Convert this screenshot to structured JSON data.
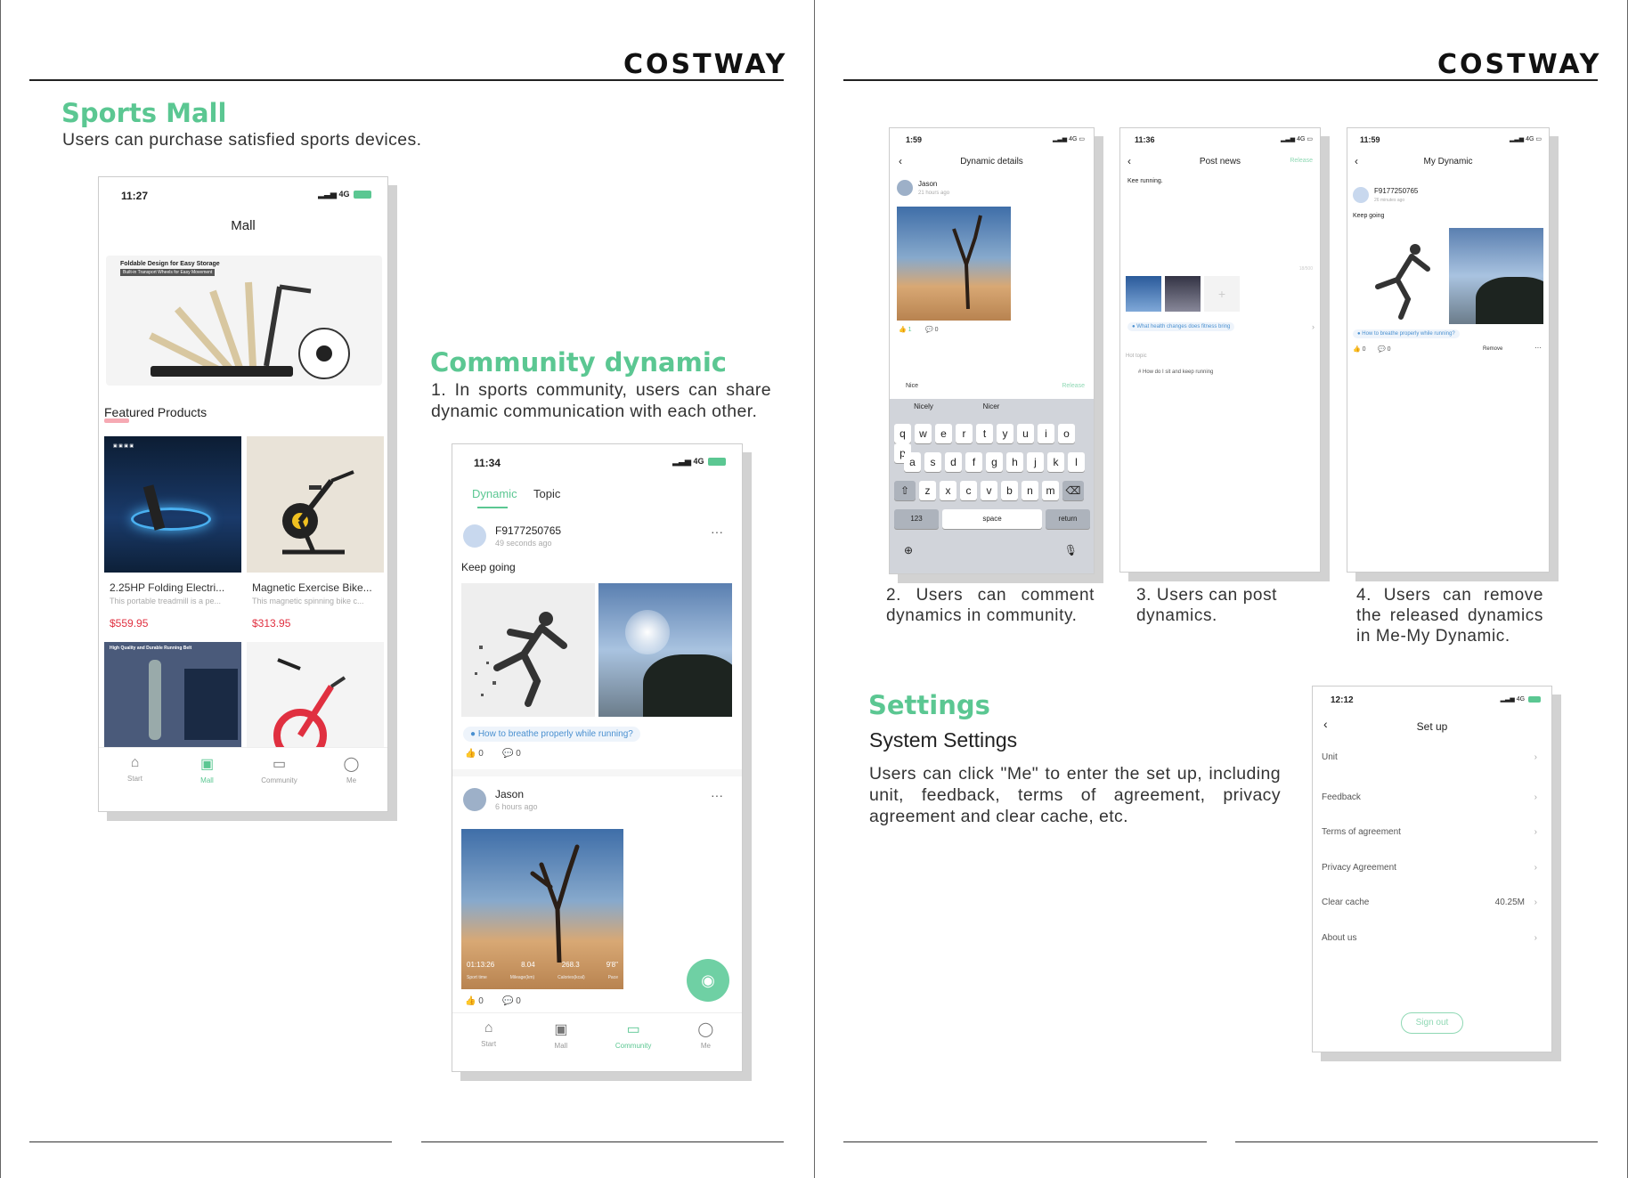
{
  "brand": "COSTWAY",
  "left_page": {
    "sports_mall": {
      "title": "Sports Mall",
      "subtitle": "Users can purchase satisfied sports devices."
    },
    "community": {
      "title": "Community dynamic",
      "caption": "1. In sports community, users can share dynamic communication with each other."
    },
    "mall_phone": {
      "time": "11:27",
      "signal": "4G",
      "header": "Mall",
      "banner_title": "Foldable Design for Easy Storage",
      "banner_sub": "Built-in Transport Wheels for Easy Movement",
      "featured": "Featured Products",
      "products": [
        {
          "name": "2.25HP Folding Electri...",
          "desc": "This portable treadmill is a pe...",
          "price": "$559.95"
        },
        {
          "name": "Magnetic Exercise Bike...",
          "desc": "This magnetic spinning bike c...",
          "price": "$313.95"
        }
      ],
      "product3_banner": "High Quality and Durable Running Belt",
      "tabs": [
        "Start",
        "Mall",
        "Community",
        "Me"
      ]
    },
    "community_phone": {
      "time": "11:34",
      "signal": "4G",
      "tab_dynamic": "Dynamic",
      "tab_topic": "Topic",
      "post1": {
        "user": "F9177250765",
        "ago": "49 seconds ago",
        "text": "Keep going",
        "topic": "How to breathe properly while running?",
        "likes": "0",
        "comments": "0"
      },
      "post2": {
        "user": "Jason",
        "ago": "6 hours ago",
        "likes": "0",
        "comments": "0",
        "stats": [
          "01:13:26",
          "8.04",
          "268.3",
          "9'8\""
        ],
        "stat_labels": [
          "Sport time",
          "Mileage(km)",
          "Calories(kcal)",
          "Pace"
        ]
      },
      "tabs": [
        "Start",
        "Mall",
        "Community",
        "Me"
      ]
    }
  },
  "right_page": {
    "phone_dynamic_details": {
      "time": "1:59",
      "title": "Dynamic details",
      "user": "Jason",
      "ago": "21 hours ago",
      "likes": "1",
      "comments": "0",
      "input": "Nice",
      "release": "Release",
      "suggestions": [
        "Nicely",
        "Nicer"
      ],
      "row1": [
        "q",
        "w",
        "e",
        "r",
        "t",
        "y",
        "u",
        "i",
        "o",
        "p"
      ],
      "row2": [
        "a",
        "s",
        "d",
        "f",
        "g",
        "h",
        "j",
        "k",
        "l"
      ],
      "row3": [
        "z",
        "x",
        "c",
        "v",
        "b",
        "n",
        "m"
      ],
      "k123": "123",
      "space": "space",
      "return": "return"
    },
    "phone_post_news": {
      "time": "11:36",
      "title": "Post news",
      "release": "Release",
      "text": "Kee running.",
      "counter": "18/500",
      "topic": "What health changes does fitness bring",
      "hot_topic": "Hot topic",
      "hot_item": "# How do I sit and keep running"
    },
    "phone_my_dynamic": {
      "time": "11:59",
      "title": "My Dynamic",
      "user": "F9177250765",
      "ago": "26 minutes ago",
      "text": "Keep going",
      "topic": "How to breathe properly while running?",
      "likes": "0",
      "comments": "0",
      "remove": "Remove"
    },
    "captions": {
      "c2": "2. Users can comment dynamics in community.",
      "c3": "3. Users can post dynamics.",
      "c4": "4. Users can remove the released dynamics in Me-My Dynamic."
    },
    "settings": {
      "title": "Settings",
      "subtitle": "System Settings",
      "body": "Users can click \"Me\" to enter the set up, including unit, feedback, terms of agreement, privacy agreement and clear cache, etc."
    },
    "phone_setup": {
      "time": "12:12",
      "signal": "4G",
      "title": "Set up",
      "rows": [
        "Unit",
        "Feedback",
        "Terms of agreement",
        "Privacy Agreement",
        "Clear cache",
        "About us"
      ],
      "cache_value": "40.25M",
      "sign_out": "Sign out"
    }
  }
}
